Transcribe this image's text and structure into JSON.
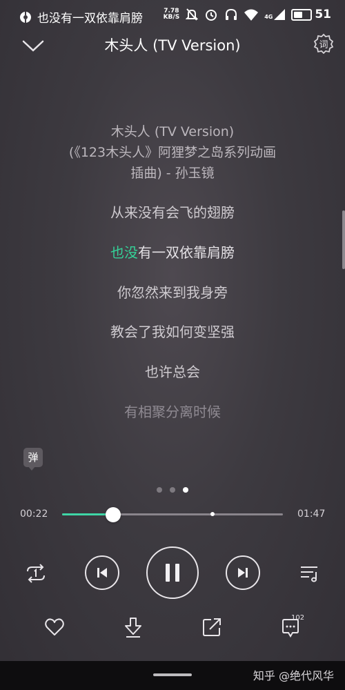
{
  "status_bar": {
    "notification_text": "也没有一双依靠肩膀",
    "net_speed_value": "7.78",
    "net_speed_unit": "KB/S",
    "network": "4G",
    "battery": "51"
  },
  "header": {
    "title": "木头人 (TV Version)",
    "lyrics_mode_label": "词"
  },
  "lyrics": {
    "song_info": [
      "木头人 (TV Version)",
      "(《123木头人》阿狸梦之岛系列动画",
      "插曲) - 孙玉镜"
    ],
    "line1": "从来没有会飞的翅膀",
    "current_highlight": "也没",
    "current_rest": "有一双依靠肩膀",
    "line3": "你忽然来到我身旁",
    "line4": "教会了我如何变坚强",
    "line5": "也许总会",
    "line6": "有相聚分离时候"
  },
  "danmaku_label": "弹",
  "pager": {
    "count": 3,
    "active_index": 2
  },
  "player": {
    "current_time": "00:22",
    "total_time": "01:47",
    "progress": 0.23,
    "buffered": 0.68,
    "accent_color": "#3fd6a6"
  },
  "controls": {
    "repeat_icon": "repeat-one-icon",
    "prev_icon": "previous-track-icon",
    "play_pause_icon": "pause-icon",
    "next_icon": "next-track-icon",
    "playlist_icon": "playlist-icon"
  },
  "actions": {
    "like_icon": "heart-icon",
    "download_icon": "download-icon",
    "share_icon": "share-icon",
    "comment_icon": "comment-icon",
    "comment_count": "102"
  },
  "watermark": "知乎 @绝代风华"
}
